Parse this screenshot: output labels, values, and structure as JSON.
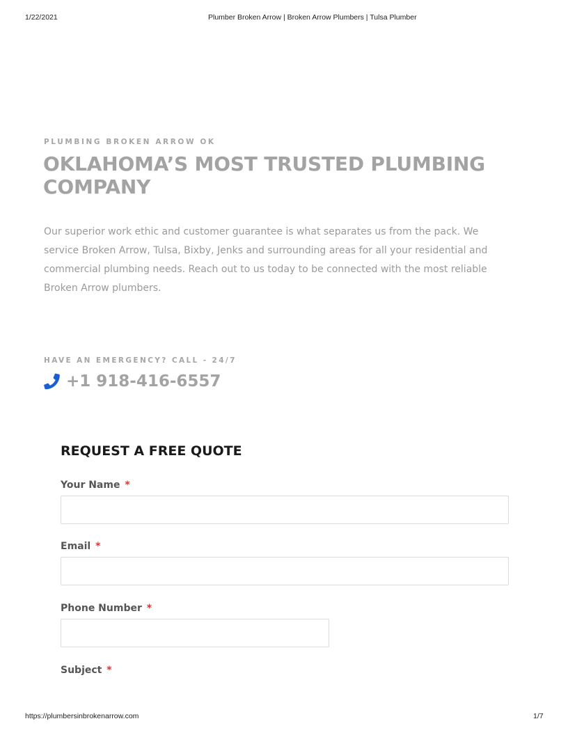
{
  "print_header": {
    "date": "1/22/2021",
    "title": "Plumber Broken Arrow | Broken Arrow Plumbers | Tulsa Plumber"
  },
  "hero": {
    "eyebrow": "PLUMBING BROKEN ARROW OK",
    "headline": "OKLAHOMA’S MOST TRUSTED PLUMBING COMPANY",
    "intro": "Our superior work ethic and customer guarantee is what separates us from the pack. We service Broken Arrow, Tulsa, Bixby, Jenks and surrounding areas for all your residential and commercial plumbing needs. Reach out to us today to be connected with the most reliable Broken Arrow plumbers."
  },
  "emergency": {
    "label": "HAVE AN EMERGENCY? CALL - 24/7",
    "phone": "+1 918-416-6557",
    "icon": "phone-icon",
    "icon_color": "#1a5fd1"
  },
  "quote_form": {
    "title": "REQUEST A FREE QUOTE",
    "required_marker": "*",
    "fields": {
      "name": {
        "label": "Your Name",
        "value": ""
      },
      "email": {
        "label": "Email",
        "value": ""
      },
      "phone": {
        "label": "Phone Number",
        "value": ""
      },
      "subject": {
        "label": "Subject"
      }
    }
  },
  "print_footer": {
    "url": "https://plumbersinbrokenarrow.com",
    "page": "1/7"
  },
  "colors": {
    "heading_gray": "#a3a3a3",
    "required_red": "#d63638",
    "accent_blue": "#1a5fd1"
  }
}
